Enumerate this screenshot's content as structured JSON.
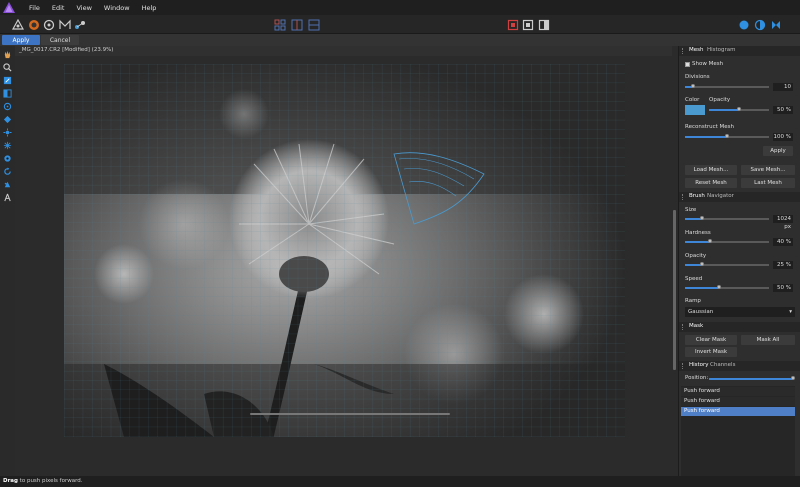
{
  "menu": [
    "File",
    "Edit",
    "View",
    "Window",
    "Help"
  ],
  "context": {
    "apply": "Apply",
    "cancel": "Cancel"
  },
  "document": {
    "tab_title": "_MG_0017.CR2 [Modified] (23.9%)"
  },
  "status": {
    "bold": "Drag",
    "text": " to push pixels forward."
  },
  "mesh_panel": {
    "tabs": [
      "Mesh",
      "Histogram"
    ],
    "show_mesh": "Show Mesh",
    "show_mesh_checked": true,
    "divisions_label": "Divisions",
    "divisions_value": "10",
    "divisions_fraction": 0.1,
    "color_label": "Color",
    "color_swatch": "#4a9ad0",
    "opacity_label": "Opacity",
    "opacity_value": "50 %",
    "opacity_fraction": 0.5,
    "reconstruct_label": "Reconstruct Mesh",
    "reconstruct_value": "100 %",
    "reconstruct_fraction": 0.5,
    "apply_label": "Apply",
    "load_mesh": "Load Mesh...",
    "save_mesh": "Save Mesh...",
    "reset_mesh": "Reset Mesh",
    "last_mesh": "Last Mesh"
  },
  "brush_panel": {
    "tabs": [
      "Brush",
      "Navigator"
    ],
    "size_label": "Size",
    "size_value": "1024 px",
    "size_fraction": 0.2,
    "hardness_label": "Hardness",
    "hardness_value": "40 %",
    "hardness_fraction": 0.3,
    "opacity_label": "Opacity",
    "opacity_value": "25 %",
    "opacity_fraction": 0.2,
    "speed_label": "Speed",
    "speed_value": "50 %",
    "speed_fraction": 0.4,
    "ramp_label": "Ramp",
    "ramp_value": "Gaussian"
  },
  "mask_panel": {
    "tabs": [
      "Mask"
    ],
    "clear_mask": "Clear Mask",
    "mask_all": "Mask All",
    "invert_mask": "Invert Mask"
  },
  "history_panel": {
    "tabs": [
      "History",
      "Channels"
    ],
    "position_label": "Position:",
    "position_fraction": 1.0,
    "items": [
      "Push forward",
      "Push forward",
      "Push forward"
    ],
    "selected_index": 2
  },
  "colors": {
    "accent": "#3d74c4",
    "mesh_line": "#4a9ad0",
    "selected_row": "#4f7fc7"
  }
}
